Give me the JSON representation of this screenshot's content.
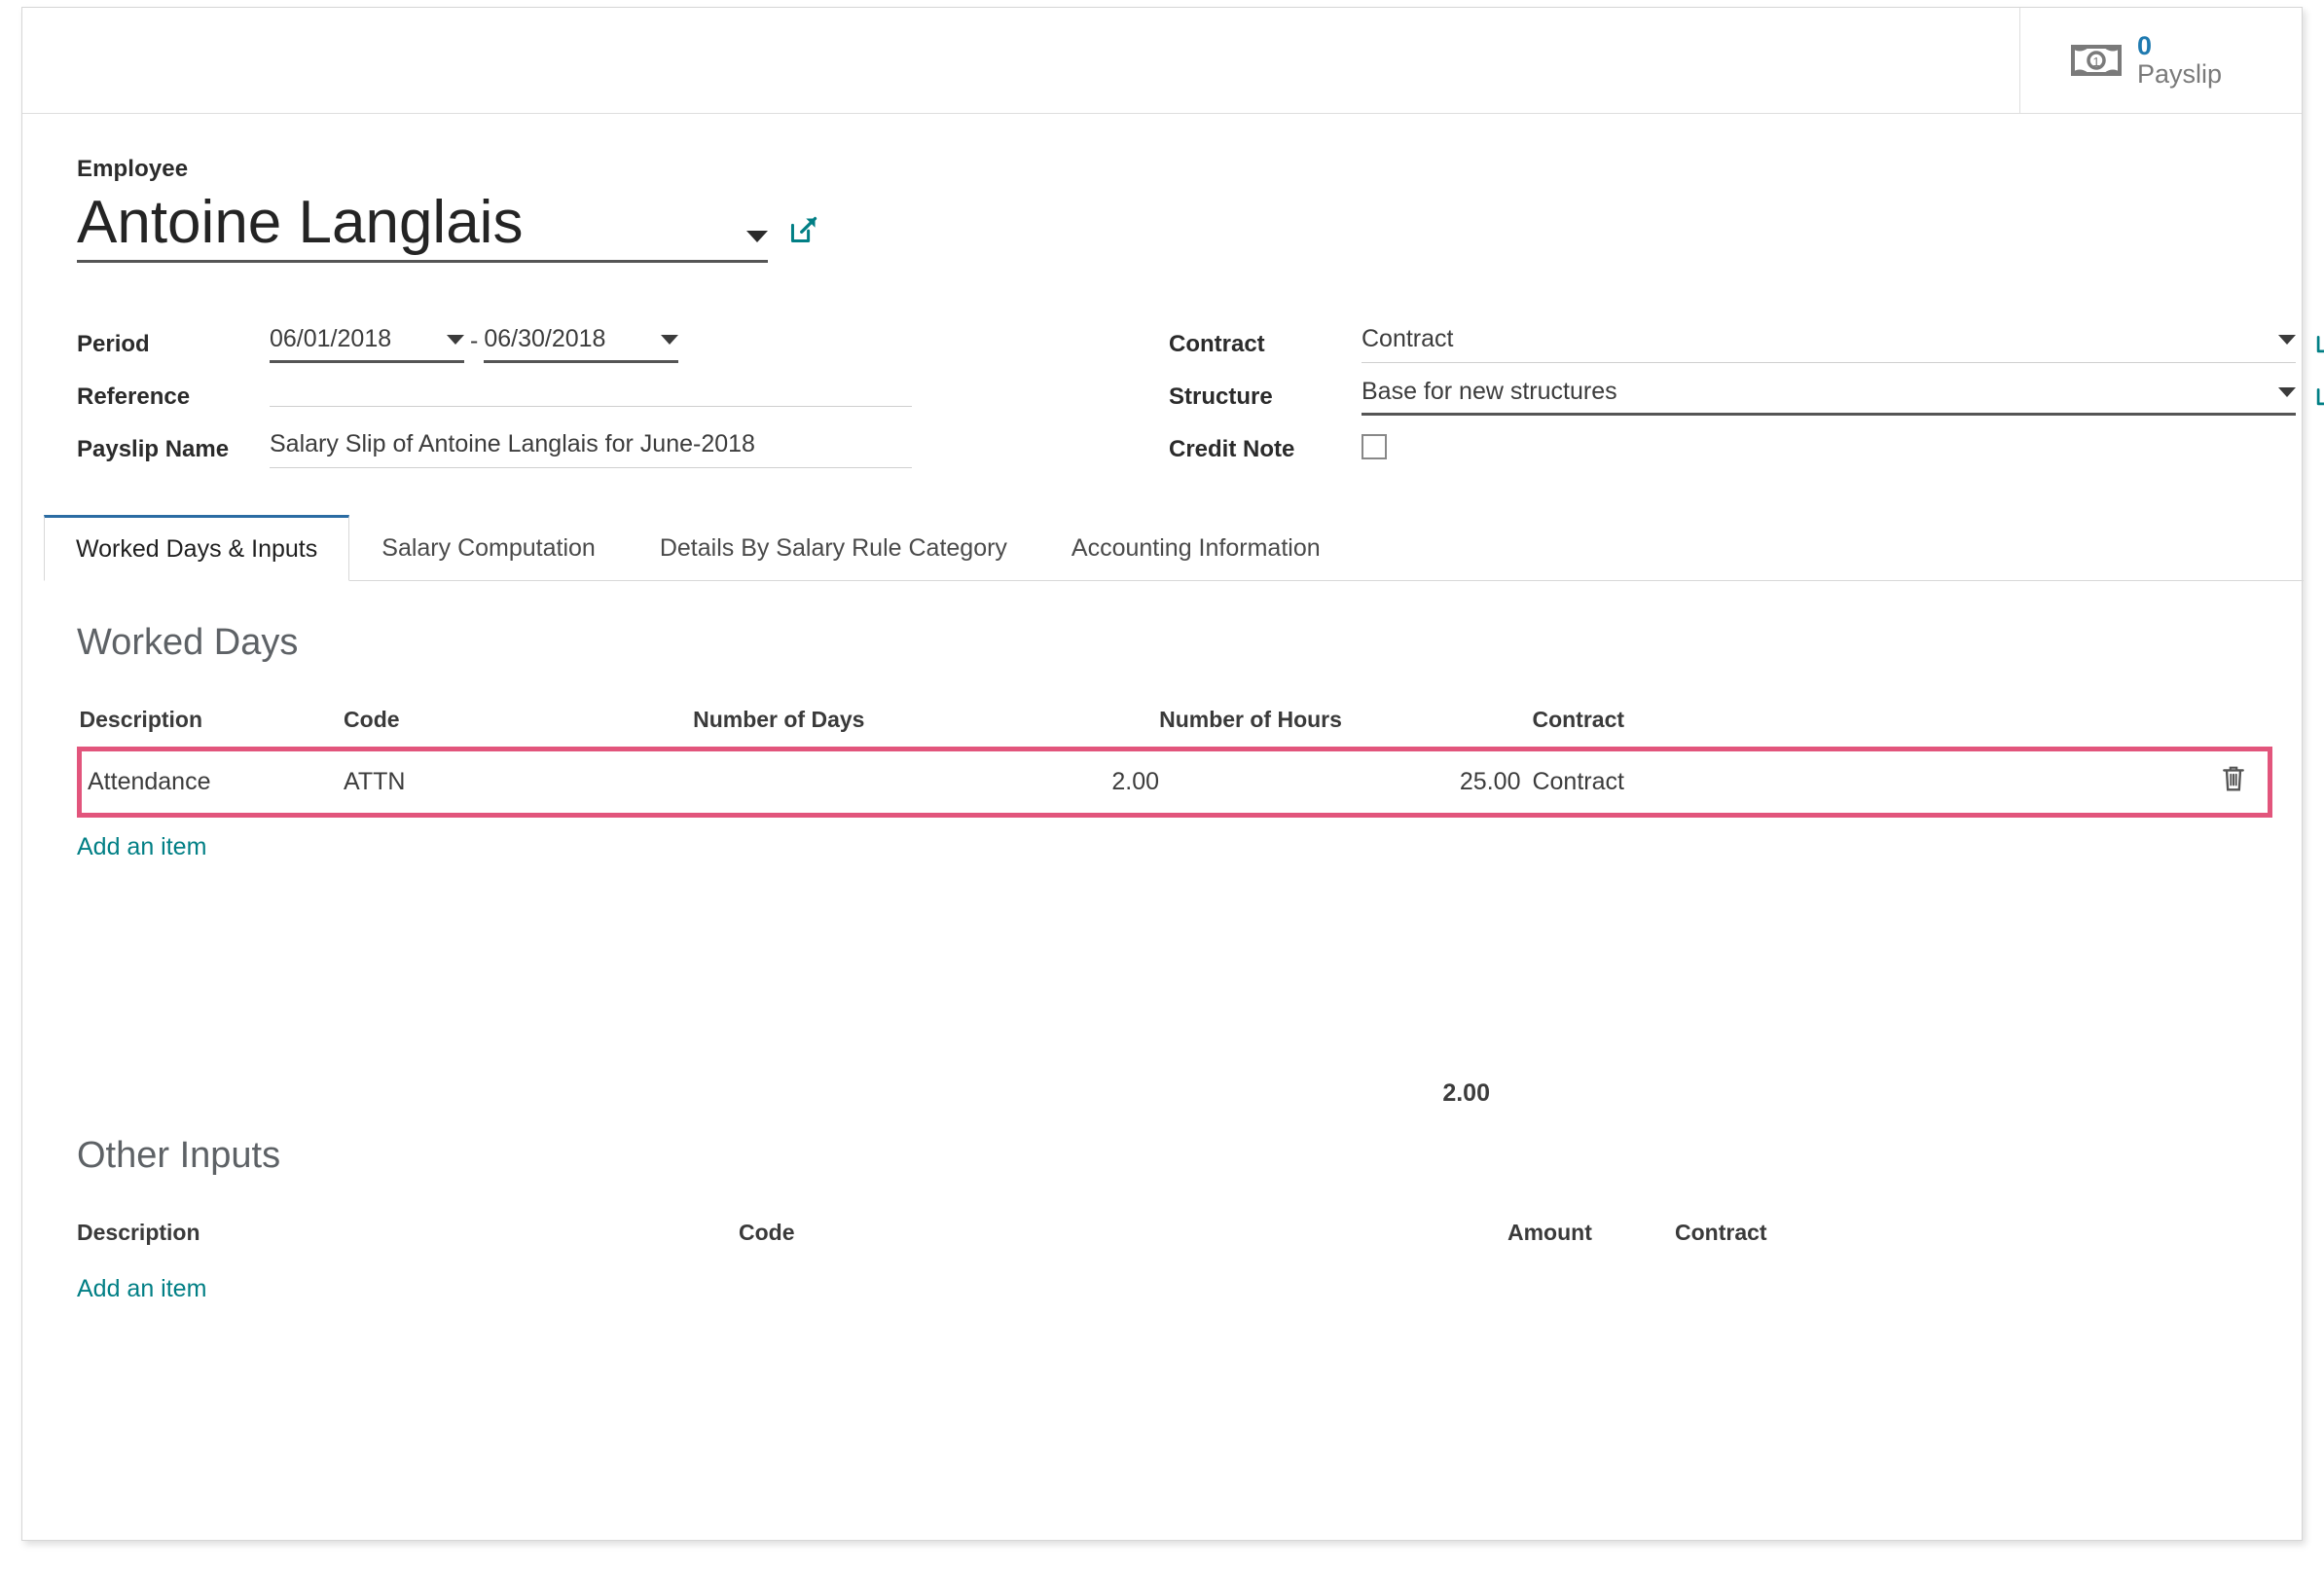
{
  "stat_button": {
    "icon": "banknote-icon",
    "value": "0",
    "label": "Payslip"
  },
  "header": {
    "employee_label": "Employee",
    "employee_value": "Antoine Langlais",
    "dropdown_icon": "chevron-down-icon",
    "external_link_icon": "external-link-icon"
  },
  "form": {
    "left": {
      "period_label": "Period",
      "period_from": "06/01/2018",
      "period_separator": "-",
      "period_to": "06/30/2018",
      "reference_label": "Reference",
      "reference_value": "",
      "payslip_name_label": "Payslip Name",
      "payslip_name_value": "Salary Slip of Antoine Langlais for June-2018"
    },
    "right": {
      "contract_label": "Contract",
      "contract_value": "Contract",
      "structure_label": "Structure",
      "structure_value": "Base for new structures",
      "credit_note_label": "Credit Note",
      "credit_note_checked": false
    }
  },
  "tabs": [
    {
      "label": "Worked Days & Inputs",
      "active": true
    },
    {
      "label": "Salary Computation",
      "active": false
    },
    {
      "label": "Details By Salary Rule Category",
      "active": false
    },
    {
      "label": "Accounting Information",
      "active": false
    }
  ],
  "worked_days": {
    "title": "Worked Days",
    "columns": [
      "Description",
      "Code",
      "Number of Days",
      "Number of Hours",
      "Contract"
    ],
    "rows": [
      {
        "description": "Attendance",
        "code": "ATTN",
        "number_of_days": "2.00",
        "number_of_hours": "25.00",
        "contract": "Contract",
        "delete_icon": "trash-icon",
        "highlighted": true
      }
    ],
    "add_item": "Add an item",
    "total_days": "2.00"
  },
  "other_inputs": {
    "title": "Other Inputs",
    "columns": [
      "Description",
      "Code",
      "Amount",
      "Contract"
    ],
    "rows": [],
    "add_item": "Add an item"
  },
  "colors": {
    "accent_teal": "#017f85",
    "accent_blue": "#1f7ab0",
    "tab_active_border": "#2b6ca3",
    "highlight_pink": "#e2557c"
  }
}
